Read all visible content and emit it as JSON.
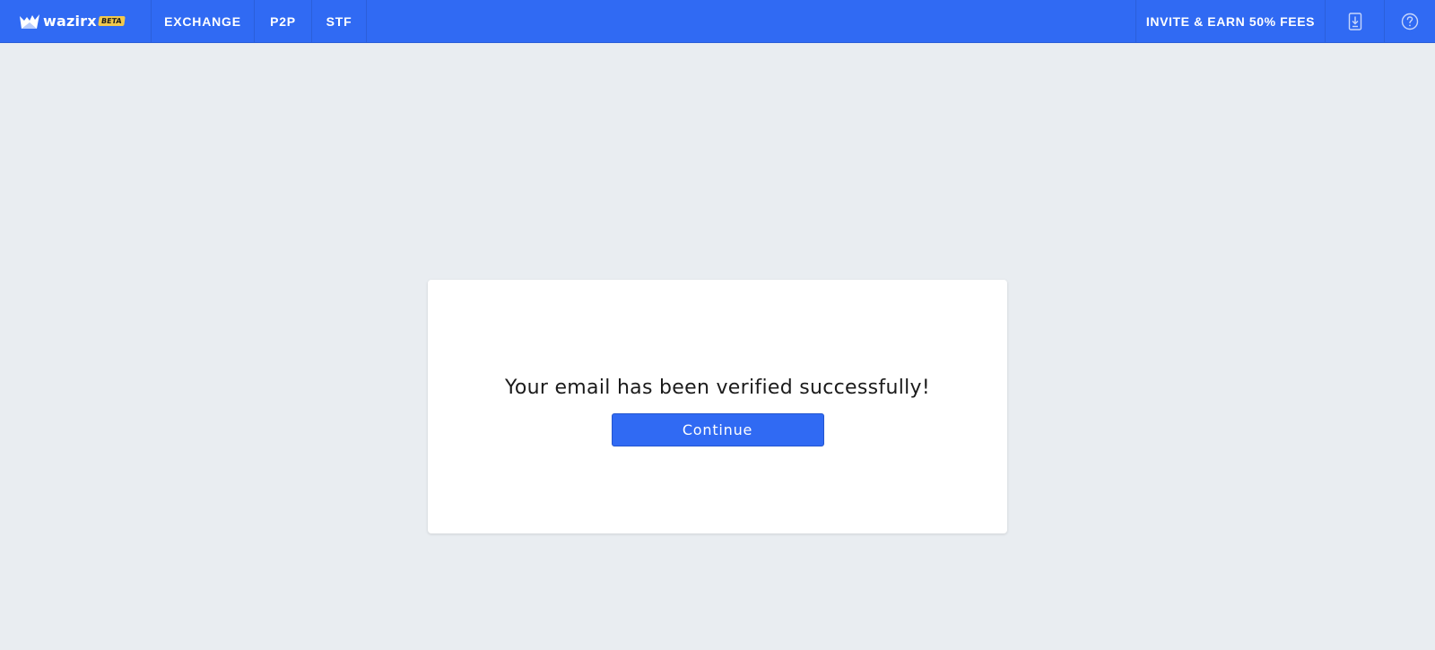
{
  "header": {
    "brand": {
      "name": "wazirx",
      "badge": "BETA",
      "logo_icon": "wazirx-logo-icon"
    },
    "nav": [
      {
        "label": "EXCHANGE"
      },
      {
        "label": "P2P"
      },
      {
        "label": "STF"
      }
    ],
    "invite_label": "INVITE & EARN 50% FEES",
    "download_icon": "download-app-icon",
    "help_icon": "help-icon"
  },
  "main": {
    "message": "Your email has been verified successfully!",
    "continue_label": "Continue"
  },
  "colors": {
    "brand_blue": "#306af3",
    "background": "#e9edf1",
    "badge_yellow": "#f2c94c"
  }
}
